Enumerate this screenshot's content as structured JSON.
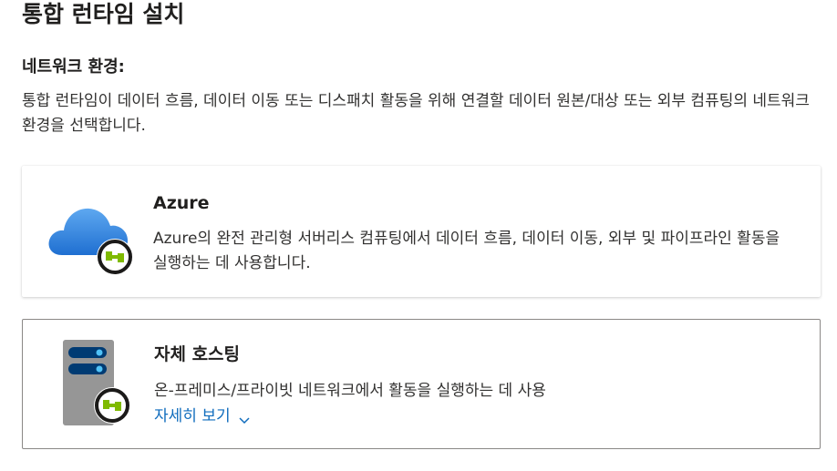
{
  "page": {
    "title": "통합 런타임 설치",
    "section_heading": "네트워크 환경:",
    "description": "통합 런타임이 데이터 흐름, 데이터 이동 또는 디스패치 활동을 위해 연결할 데이터 원본/대상 또는 외부 컴퓨팅의 네트워크 환경을 선택합니다."
  },
  "options": [
    {
      "title": "Azure",
      "description": "Azure의 완전 관리형 서버리스 컴퓨팅에서 데이터 흐름, 데이터 이동, 외부 및 파이프라인 활동을 실행하는 데 사용합니다.",
      "icon": "azure-cloud-icon",
      "selected": false
    },
    {
      "title": "자체 호스팅",
      "description": "온-프레미스/프라이빗 네트워크에서 활동을 실행하는 데 사용",
      "learn_more": "자세히 보기",
      "icon": "server-icon",
      "selected": true
    }
  ],
  "colors": {
    "link": "#0f6cbd",
    "cloud": "#2f86e0",
    "badge_green": "#7fba00",
    "server_body": "#8c8c8c",
    "server_slot": "#003b73"
  }
}
